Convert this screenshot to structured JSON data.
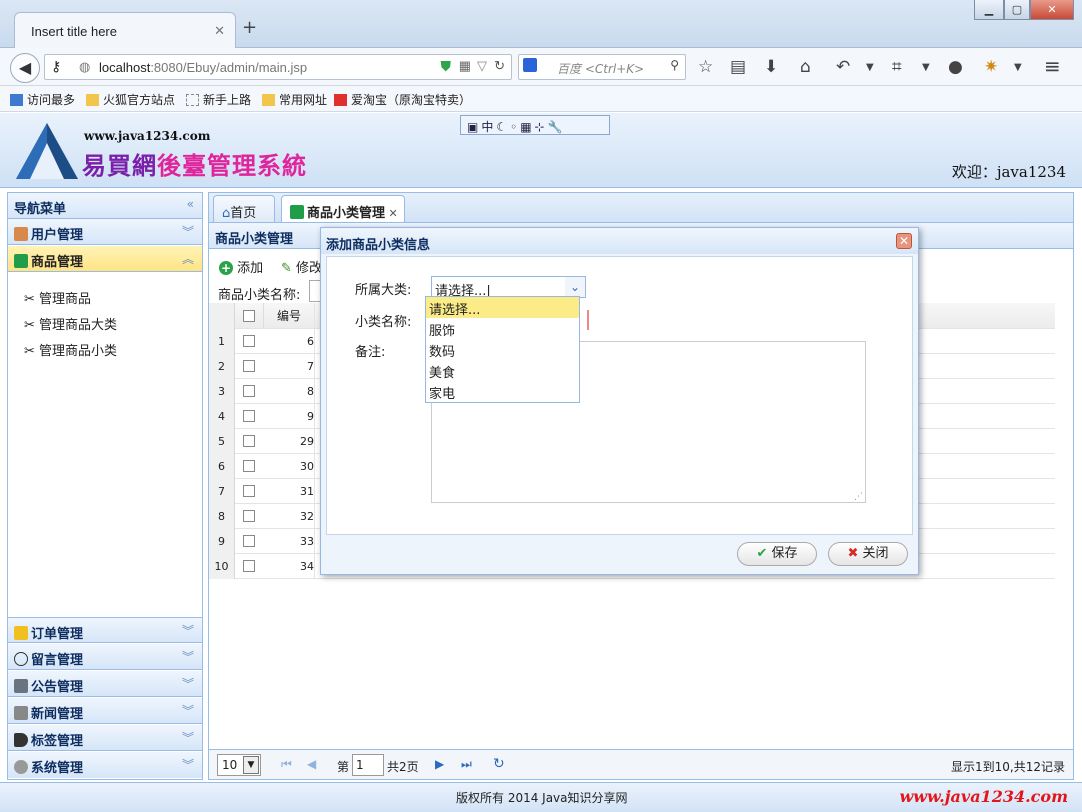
{
  "browser": {
    "tab_title": "Insert title here",
    "url_host": "localhost",
    "url_rest": ":8080/Ebuy/admin/main.jsp",
    "search_placeholder": "百度 <Ctrl+K>",
    "bookmarks": [
      "访问最多",
      "火狐官方站点",
      "新手上路",
      "常用网址",
      "爱淘宝（原淘宝特卖）"
    ]
  },
  "header": {
    "site_url": "www.java1234.com",
    "title_part1": "易買網",
    "title_part2": "後臺管理系統",
    "welcome": "欢迎：java1234",
    "ime_label": "中"
  },
  "leftnav": {
    "title": "导航菜单",
    "groups": [
      {
        "label": "用户管理"
      },
      {
        "label": "商品管理"
      },
      {
        "label": "订单管理"
      },
      {
        "label": "留言管理"
      },
      {
        "label": "公告管理"
      },
      {
        "label": "新闻管理"
      },
      {
        "label": "标签管理"
      },
      {
        "label": "系统管理"
      }
    ],
    "items": [
      "管理商品",
      "管理商品大类",
      "管理商品小类"
    ]
  },
  "tabs": {
    "home": "首页",
    "current": "商品小类管理"
  },
  "panel": {
    "title": "商品小类管理",
    "add": "添加",
    "edit": "修改",
    "search_label": "商品小类名称:",
    "col_id": "编号",
    "rows": [
      {
        "n": "1",
        "id": "6"
      },
      {
        "n": "2",
        "id": "7"
      },
      {
        "n": "3",
        "id": "8"
      },
      {
        "n": "4",
        "id": "9"
      },
      {
        "n": "5",
        "id": "29"
      },
      {
        "n": "6",
        "id": "30"
      },
      {
        "n": "7",
        "id": "31"
      },
      {
        "n": "8",
        "id": "32"
      },
      {
        "n": "9",
        "id": "33"
      },
      {
        "n": "10",
        "id": "34"
      }
    ]
  },
  "pager": {
    "page_size": "10",
    "page_prefix": "第",
    "page_value": "1",
    "page_total": "共2页",
    "summary": "显示1到10,共12记录"
  },
  "dialog": {
    "title": "添加商品小类信息",
    "label_category": "所属大类:",
    "label_name": "小类名称:",
    "label_remark": "备注:",
    "select_value": "请选择...",
    "options": [
      "请选择...",
      "服饰",
      "数码",
      "美食",
      "家电"
    ],
    "save": "保存",
    "close": "关闭"
  },
  "footer": {
    "copyright": "版权所有 2014 Java知识分享网",
    "watermark": "www.java1234.com"
  },
  "colors": {
    "accent": "#99bbe8",
    "highlight": "#fbec88",
    "brand_purple": "#7a1fa8",
    "brand_pink": "#e0249c"
  }
}
